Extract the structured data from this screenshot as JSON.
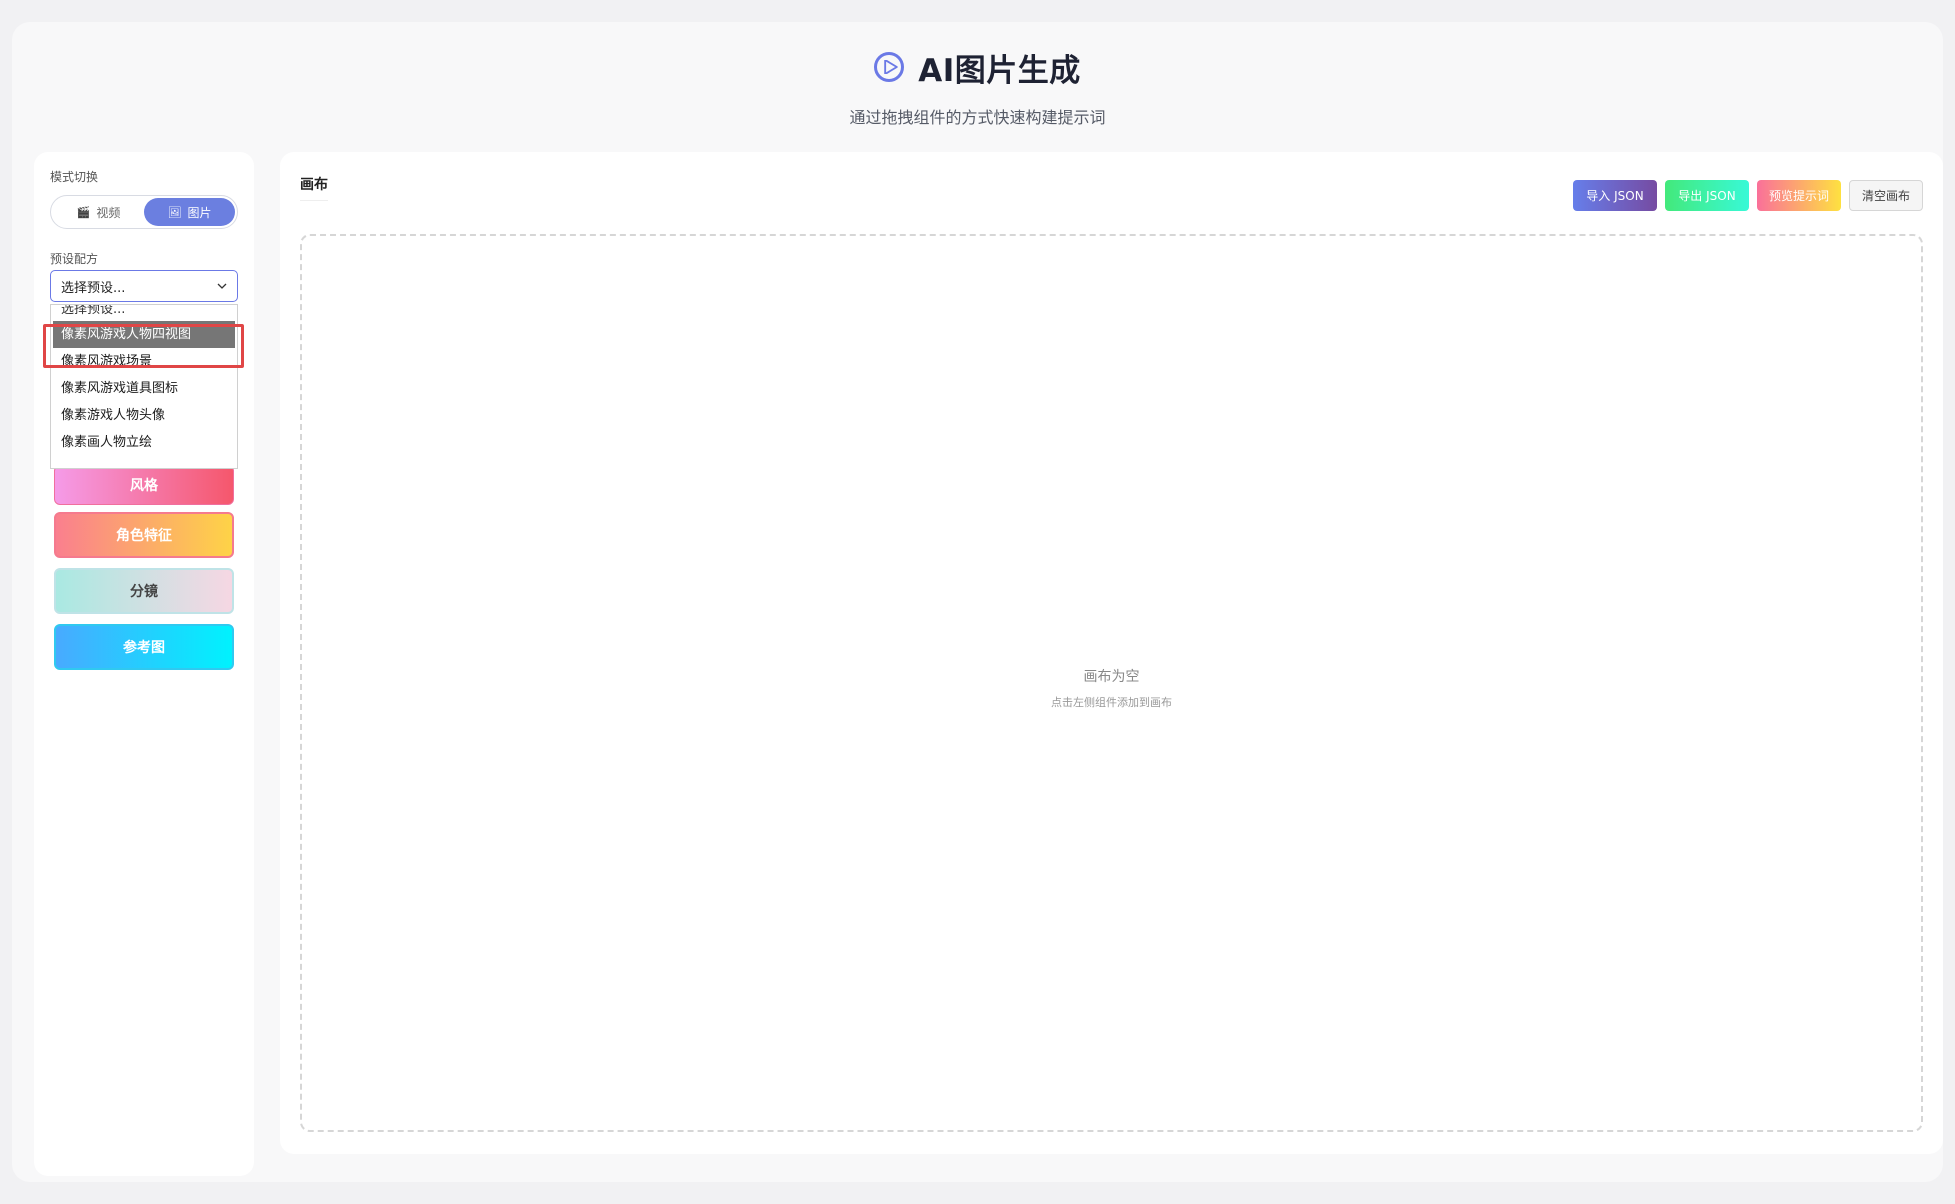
{
  "header": {
    "title": "AI图片生成",
    "subtitle": "通过拖拽组件的方式快速构建提示词",
    "icon": "play-circle-icon",
    "accent_color": "#6b79e6"
  },
  "sidebar": {
    "mode_label": "模式切换",
    "modes": [
      {
        "label": "视频",
        "icon": "clapper-icon",
        "active": false
      },
      {
        "label": "图片",
        "icon": "image-icon",
        "active": true
      }
    ],
    "preset_label": "预设配方",
    "preset_select": {
      "value": "选择预设...",
      "options": [
        "选择预设...",
        "像素风游戏人物四视图",
        "像素风游戏场景",
        "像素风游戏道具图标",
        "像素游戏人物头像",
        "像素画人物立绘"
      ],
      "highlighted_index": 1
    },
    "components": [
      {
        "label": "风格"
      },
      {
        "label": "角色特征"
      },
      {
        "label": "分镜"
      },
      {
        "label": "参考图"
      }
    ]
  },
  "main": {
    "canvas_label": "画布",
    "toolbar": {
      "import": "导入 JSON",
      "export": "导出 JSON",
      "preview": "预览提示词",
      "clear": "清空画布"
    },
    "empty": {
      "title": "画布为空",
      "hint": "点击左侧组件添加到画布"
    }
  }
}
